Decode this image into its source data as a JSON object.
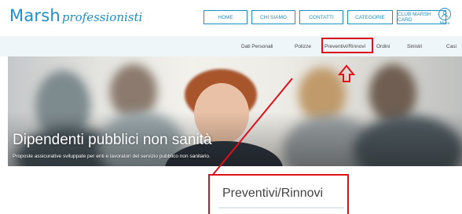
{
  "brand": {
    "main": "Marsh",
    "sub": "professionisti",
    "color": "#1e8fc5"
  },
  "top_nav": [
    "HOME",
    "CHI SIAMO",
    "CONTATTI",
    "CATEGORIE",
    "CLUB MARSH CARD"
  ],
  "menu": {
    "label": "Menu",
    "icon": "user-circle-icon"
  },
  "sub_nav": [
    "Dati Personali",
    "Polizze",
    "Preventivi/Rinnovi",
    "Ordini",
    "Sinistri",
    "Casi"
  ],
  "hero": {
    "title": "Dipendenti pubblici non sanità",
    "subtitle": "Proposte assicurative sviluppate per enti e lavoratori del servizio pubblico non sanitario."
  },
  "zoom": {
    "label": "Preventivi/Rinnovi"
  },
  "colors": {
    "accent": "#1e8fc5",
    "highlight": "#e0101a"
  }
}
